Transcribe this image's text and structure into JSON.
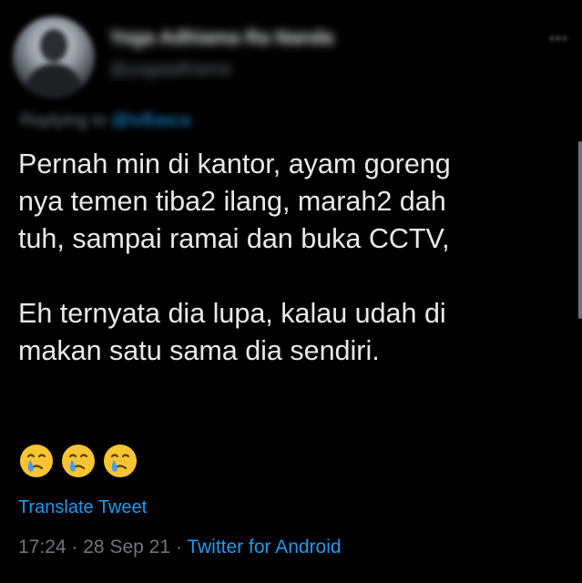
{
  "author": {
    "display_name": "Yoga Adhiama Ra Nanda",
    "handle": "@yogaadhiama"
  },
  "replying": {
    "prefix": "Replying to",
    "mention": "@tvBasca"
  },
  "tweet": {
    "lines": [
      "Pernah min di kantor, ayam goreng",
      "nya temen tiba2 ilang, marah2 dah",
      "tuh, sampai ramai dan buka CCTV,",
      "",
      "Eh ternyata dia lupa, kalau udah di",
      "makan satu sama dia sendiri."
    ],
    "emojis": [
      "crying-face",
      "crying-face",
      "crying-face"
    ]
  },
  "translate_label": "Translate Tweet",
  "meta": {
    "time": "17:24",
    "separator": "·",
    "date": "28 Sep 21",
    "source": "Twitter for Android"
  },
  "colors": {
    "background": "#000000",
    "text": "#e7e9ea",
    "muted": "#71767b",
    "link": "#1d9bf0",
    "emoji_face": "#f7c531",
    "emoji_tear": "#4a9ee8"
  }
}
